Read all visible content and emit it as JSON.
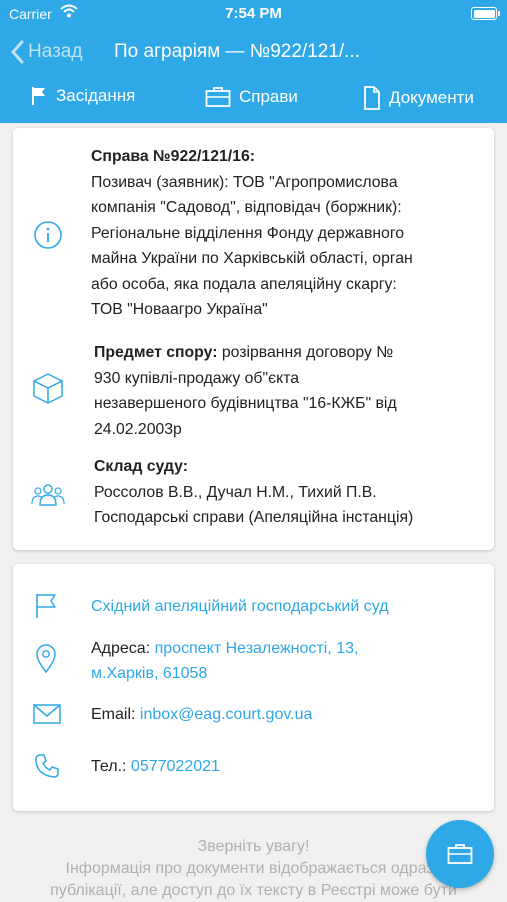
{
  "status_bar": {
    "carrier": "Carrier",
    "time": "7:54 PM"
  },
  "nav": {
    "back_label": "Назад",
    "title": "По аграріям — №922/121/..."
  },
  "tabs": [
    {
      "label": "Засідання",
      "icon": "flag-icon"
    },
    {
      "label": "Справи",
      "icon": "briefcase-icon"
    },
    {
      "label": "Документи",
      "icon": "document-icon"
    }
  ],
  "case": {
    "heading": "Справа №922/121/16:",
    "parties_lines": [
      "Позивач (заявник): ТОВ \"Агропромислова",
      "компанія \"Садовод\", відповідач (боржник):",
      "Регіональне відділення Фонду державного",
      "майна України по Харківській області, орган",
      "або особа, яка подала апеляційну скаргу:",
      "ТОВ \"Новаагро Україна\""
    ],
    "subject_label": "Предмет спору:",
    "subject_lines": [
      " розірвання договору №",
      "930 купівлі-продажу об\"єкта",
      "незавершеного будівництва \"16-КЖБ\" від",
      "24.02.2003р"
    ],
    "court_label": "Склад суду:",
    "court_lines": [
      "Россолов В.В., Дучал Н.М., Тихий П.В.",
      "Господарські справи (Апеляційна інстанція)"
    ]
  },
  "court_info": {
    "name": "Східний апеляційний господарський суд",
    "address_label": "Адреса:",
    "address_line1": "проспект Незалежності, 13,",
    "address_line2": "м.Харків, 61058",
    "email_label": "Email:",
    "email": "inbox@eag.court.gov.ua",
    "phone_label": "Тел.:",
    "phone": "0577022021"
  },
  "notice": {
    "title": "Зверніть увагу!",
    "line1": "Інформація про документи відображається одразу",
    "line2": "публікації, але доступ до їх тексту в Реєстрі може бути"
  },
  "colors": {
    "accent": "#2ea8e6",
    "background": "#f0f0f0"
  }
}
